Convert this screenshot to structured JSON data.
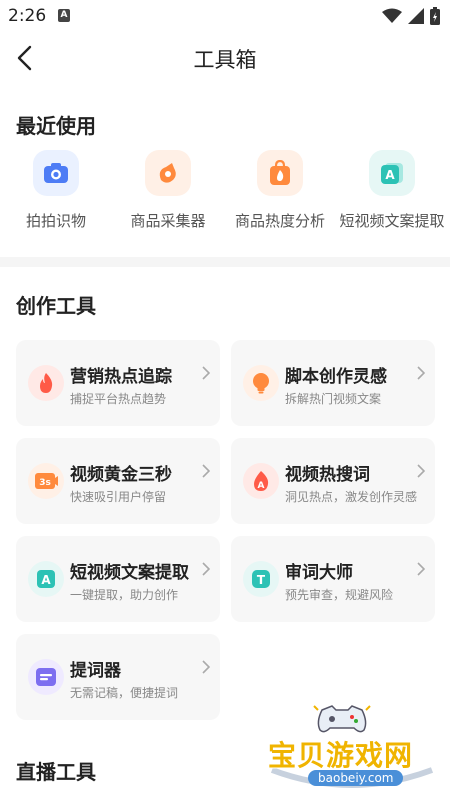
{
  "status": {
    "time": "2:26",
    "notif_glyph": "A"
  },
  "nav": {
    "title": "工具箱",
    "back_icon": "chevron-left-icon"
  },
  "recent": {
    "title": "最近使用",
    "items": [
      {
        "label": "拍拍识物",
        "icon": "camera-icon",
        "bg": "#eaf1ff",
        "fg": "#4d7cf5"
      },
      {
        "label": "商品采集器",
        "icon": "product-icon",
        "bg": "#fff0e6",
        "fg": "#ff8a3d"
      },
      {
        "label": "商品热度分析",
        "icon": "heat-bag-icon",
        "bg": "#fff0e6",
        "fg": "#ff8a3d"
      },
      {
        "label": "短视频文案提取",
        "icon": "text-extract-icon",
        "bg": "#e6f7f5",
        "fg": "#2cc2b5"
      }
    ]
  },
  "create": {
    "title": "创作工具",
    "cards": [
      {
        "title": "营销热点追踪",
        "sub": "捕捉平台热点趋势",
        "icon": "flame-icon",
        "bg": "#ffe9e6",
        "fg": "#ff5a47"
      },
      {
        "title": "脚本创作灵感",
        "sub": "拆解热门视频文案",
        "icon": "bulb-icon",
        "bg": "#fff0e6",
        "fg": "#ff8a3d"
      },
      {
        "title": "视频黄金三秒",
        "sub": "快速吸引用户停留",
        "icon": "three-seconds-icon",
        "bg": "#fff0e6",
        "fg": "#ff8a3d",
        "badge": "3s"
      },
      {
        "title": "视频热搜词",
        "sub": "洞见热点，激发创作灵感",
        "icon": "hot-search-icon",
        "bg": "#ffe9e6",
        "fg": "#ff5a47"
      },
      {
        "title": "短视频文案提取",
        "sub": "一键提取，助力创作",
        "icon": "text-extract-icon",
        "bg": "#e6f7f5",
        "fg": "#2cc2b5"
      },
      {
        "title": "审词大师",
        "sub": "预先审查，规避风险",
        "icon": "review-icon",
        "bg": "#e6f7f5",
        "fg": "#2cc2b5"
      },
      {
        "title": "提词器",
        "sub": "无需记稿，便捷提词",
        "icon": "teleprompter-icon",
        "bg": "#efeaff",
        "fg": "#7d6ef0"
      }
    ]
  },
  "live": {
    "title": "直播工具"
  },
  "watermark": {
    "name": "宝贝游戏网",
    "url": "baobeiy.com"
  }
}
